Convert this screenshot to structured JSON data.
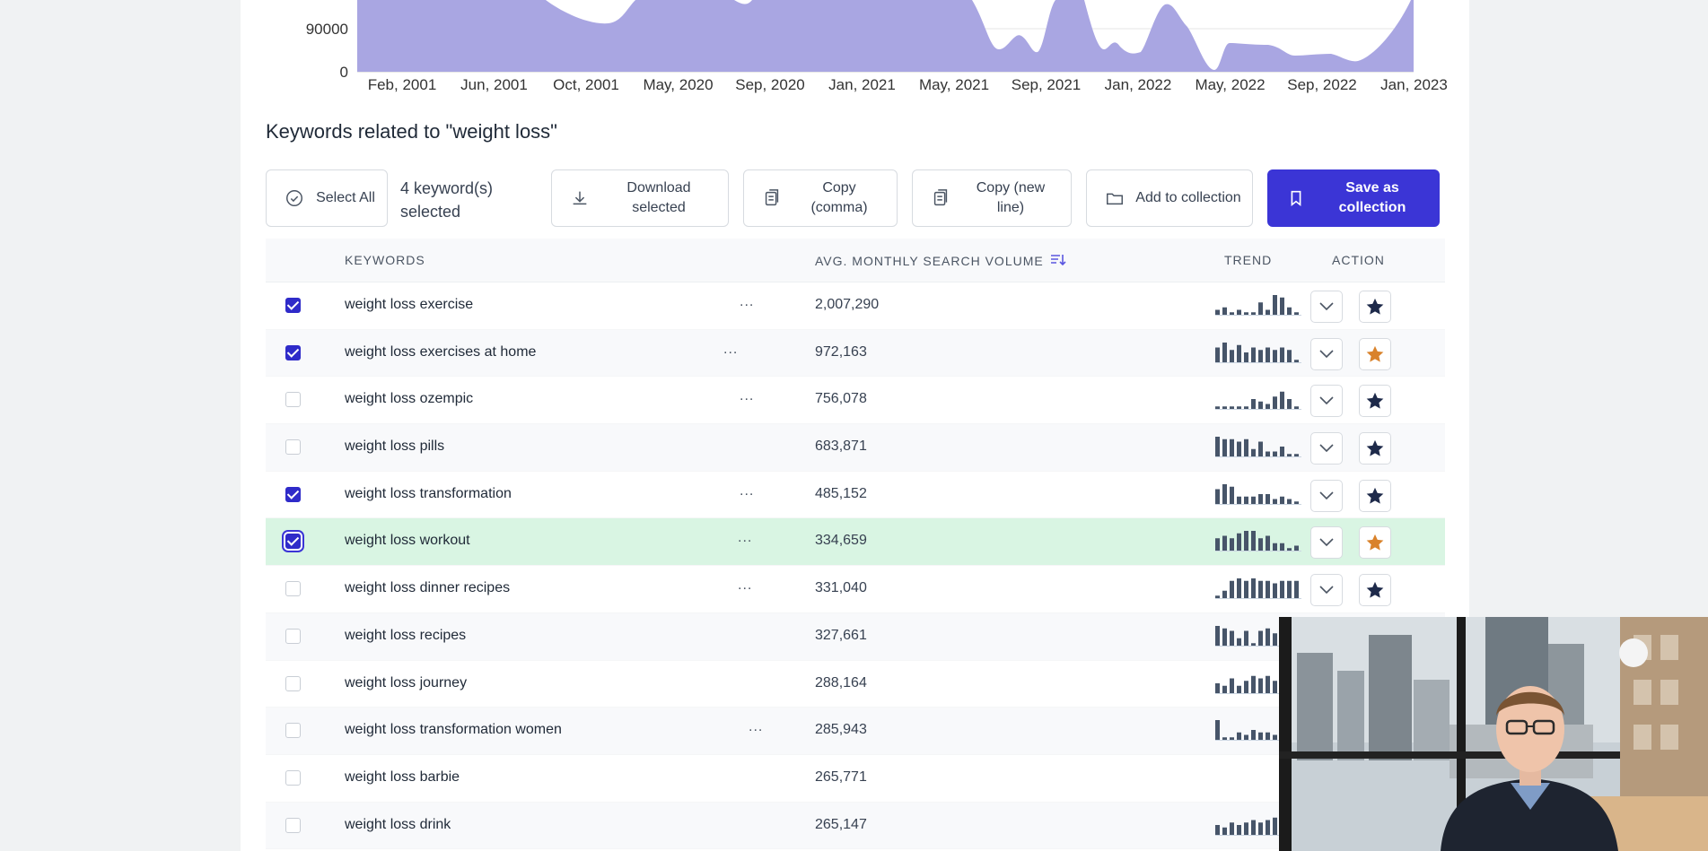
{
  "chart": {
    "y_ticks": [
      "90000",
      "0"
    ],
    "x_ticks": [
      "Feb, 2001",
      "Jun, 2001",
      "Oct, 2001",
      "May, 2020",
      "Sep, 2020",
      "Jan, 2021",
      "May, 2021",
      "Sep, 2021",
      "Jan, 2022",
      "May, 2022",
      "Sep, 2022",
      "Jan, 2023"
    ],
    "fill_color": "#a9a6e2"
  },
  "section_title": "Keywords related to \"weight loss\"",
  "toolbar": {
    "select_all": "Select All",
    "selected_count": "4 keyword(s) selected",
    "download": "Download selected",
    "copy_comma": "Copy (comma)",
    "copy_newline": "Copy (new line)",
    "add_collection": "Add to collection",
    "save_collection": "Save as collection"
  },
  "table": {
    "headers": {
      "keywords": "KEYWORDS",
      "volume": "AVG. MONTHLY SEARCH VOLUME",
      "trend": "TREND",
      "action": "ACTION"
    },
    "ellipsis": "...",
    "rows": [
      {
        "keyword": "weight loss exercise",
        "volume": "2,007,290",
        "checked": true,
        "starred": false,
        "trend": [
          2,
          3,
          1,
          2,
          1,
          1,
          5,
          2,
          8,
          7,
          3,
          1
        ]
      },
      {
        "keyword": "weight loss exercises at home",
        "volume": "972,163",
        "checked": true,
        "starred": true,
        "trend": [
          6,
          8,
          5,
          7,
          4,
          6,
          5,
          6,
          5,
          6,
          5,
          1
        ]
      },
      {
        "keyword": "weight loss ozempic",
        "volume": "756,078",
        "checked": false,
        "starred": false,
        "trend": [
          1,
          1,
          1,
          1,
          1,
          4,
          3,
          2,
          5,
          7,
          4,
          1
        ]
      },
      {
        "keyword": "weight loss pills",
        "volume": "683,871",
        "checked": false,
        "starred": false,
        "trend": [
          8,
          7,
          7,
          6,
          7,
          3,
          6,
          2,
          2,
          4,
          1,
          1
        ]
      },
      {
        "keyword": "weight loss transformation",
        "volume": "485,152",
        "checked": true,
        "starred": false,
        "trend": [
          6,
          8,
          7,
          3,
          3,
          3,
          4,
          4,
          2,
          3,
          2,
          1
        ]
      },
      {
        "keyword": "weight loss workout",
        "volume": "334,659",
        "checked": true,
        "starred": true,
        "trend": [
          5,
          6,
          5,
          7,
          8,
          8,
          5,
          6,
          3,
          3,
          1,
          2
        ]
      },
      {
        "keyword": "weight loss dinner recipes",
        "volume": "331,040",
        "checked": false,
        "starred": false,
        "trend": [
          1,
          3,
          7,
          8,
          7,
          8,
          7,
          7,
          6,
          7,
          7,
          7
        ]
      },
      {
        "keyword": "weight loss recipes",
        "volume": "327,661",
        "checked": false,
        "starred": false,
        "trend": [
          8,
          7,
          6,
          3,
          6,
          1,
          6,
          7,
          5,
          6,
          6,
          5
        ]
      },
      {
        "keyword": "weight loss journey",
        "volume": "288,164",
        "checked": false,
        "starred": false,
        "trend": [
          4,
          3,
          6,
          3,
          5,
          7,
          6,
          7,
          5,
          7,
          6,
          6
        ]
      },
      {
        "keyword": "weight loss transformation women",
        "volume": "285,943",
        "checked": false,
        "starred": false,
        "trend": [
          8,
          1,
          1,
          3,
          2,
          4,
          3,
          3,
          2,
          3,
          4,
          3
        ]
      },
      {
        "keyword": "weight loss barbie",
        "volume": "265,771",
        "checked": false,
        "starred": false,
        "trend": []
      },
      {
        "keyword": "weight loss drink",
        "volume": "265,147",
        "checked": false,
        "starred": false,
        "trend": [
          4,
          3,
          5,
          4,
          5,
          6,
          5,
          6,
          7,
          6,
          6,
          7
        ]
      }
    ]
  },
  "colors": {
    "primary": "#3b35d6",
    "star_gold": "#d9822b",
    "star_navy": "#1e2a4a",
    "highlight_row": "#d9f5e3"
  }
}
